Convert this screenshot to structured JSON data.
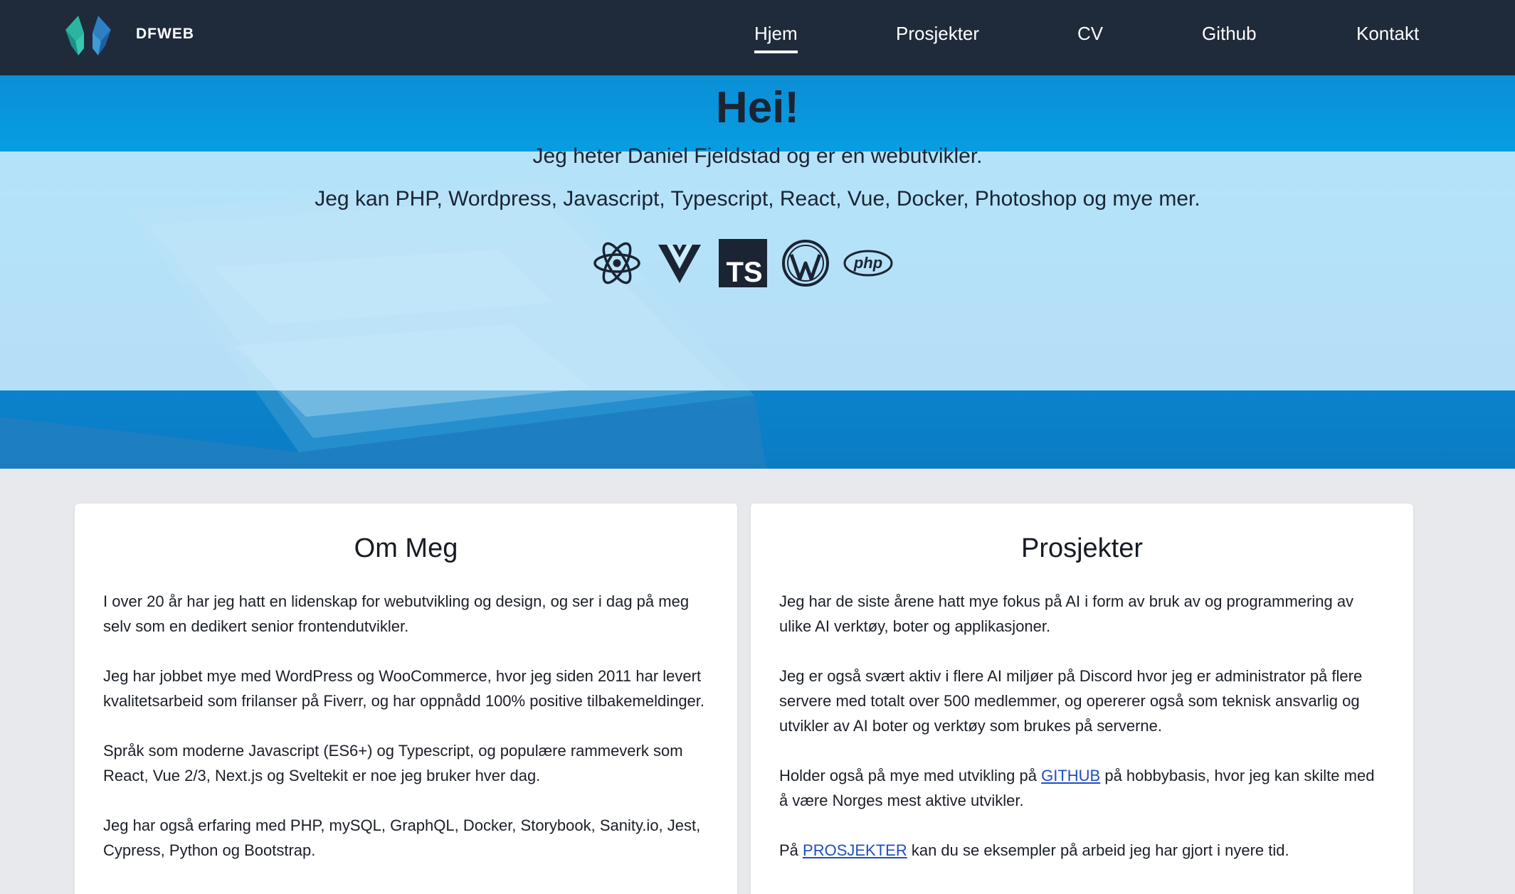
{
  "nav": {
    "brand": "DFWEB",
    "links": [
      "Hjem",
      "Prosjekter",
      "CV",
      "Github",
      "Kontakt"
    ],
    "active": "Hjem"
  },
  "hero": {
    "title": "Hei!",
    "line1": "Jeg heter Daniel Fjeldstad og er en webutvikler.",
    "line2": "Jeg kan PHP, Wordpress, Javascript, Typescript, React, Vue, Docker, Photoshop og mye mer.",
    "icons": [
      "react-icon",
      "vue-icon",
      "typescript-icon",
      "wordpress-icon",
      "php-icon"
    ],
    "ts_label": "TS",
    "php_label": "php"
  },
  "about": {
    "title": "Om Meg",
    "paragraphs": [
      "I over 20 år har jeg hatt en lidenskap for webutvikling og design, og ser i dag på meg selv som en dedikert senior frontendutvikler.",
      "Jeg har jobbet mye med WordPress og WooCommerce, hvor jeg siden 2011 har levert kvalitetsarbeid som frilanser på Fiverr, og har oppnådd 100% positive tilbakemeldinger.",
      "Språk som moderne Javascript (ES6+) og Typescript, og populære rammeverk som React, Vue 2/3, Next.js og Sveltekit er noe jeg bruker hver dag.",
      "Jeg har også erfaring med PHP, mySQL, GraphQL, Docker, Storybook, Sanity.io, Jest, Cypress, Python og Bootstrap."
    ]
  },
  "projects": {
    "title": "Prosjekter",
    "p1": "Jeg har de siste årene hatt mye fokus på AI i form av bruk av og programmering av ulike AI verktøy, boter og applikasjoner.",
    "p2": "Jeg er også svært aktiv i flere AI miljøer på Discord hvor jeg er administrator på flere servere med totalt over 500 medlemmer, og opererer også som teknisk ansvarlig og utvikler av AI boter og verktøy som brukes på serverne.",
    "p3_before": "Holder også på mye med utvikling på ",
    "p3_link": "GITHUB",
    "p3_after": " på hobbybasis, hvor jeg kan skilte med å være Norges mest aktive utvikler.",
    "p4_before": "På ",
    "p4_link": "PROSJEKTER",
    "p4_after": " kan du se eksempler på arbeid jeg har gjort i nyere tid."
  },
  "colors": {
    "nav_bg": "#1f2a3a",
    "hero_blue": "#06a5e8",
    "link": "#1d4fc4",
    "page_bg": "#e8e9ec"
  }
}
